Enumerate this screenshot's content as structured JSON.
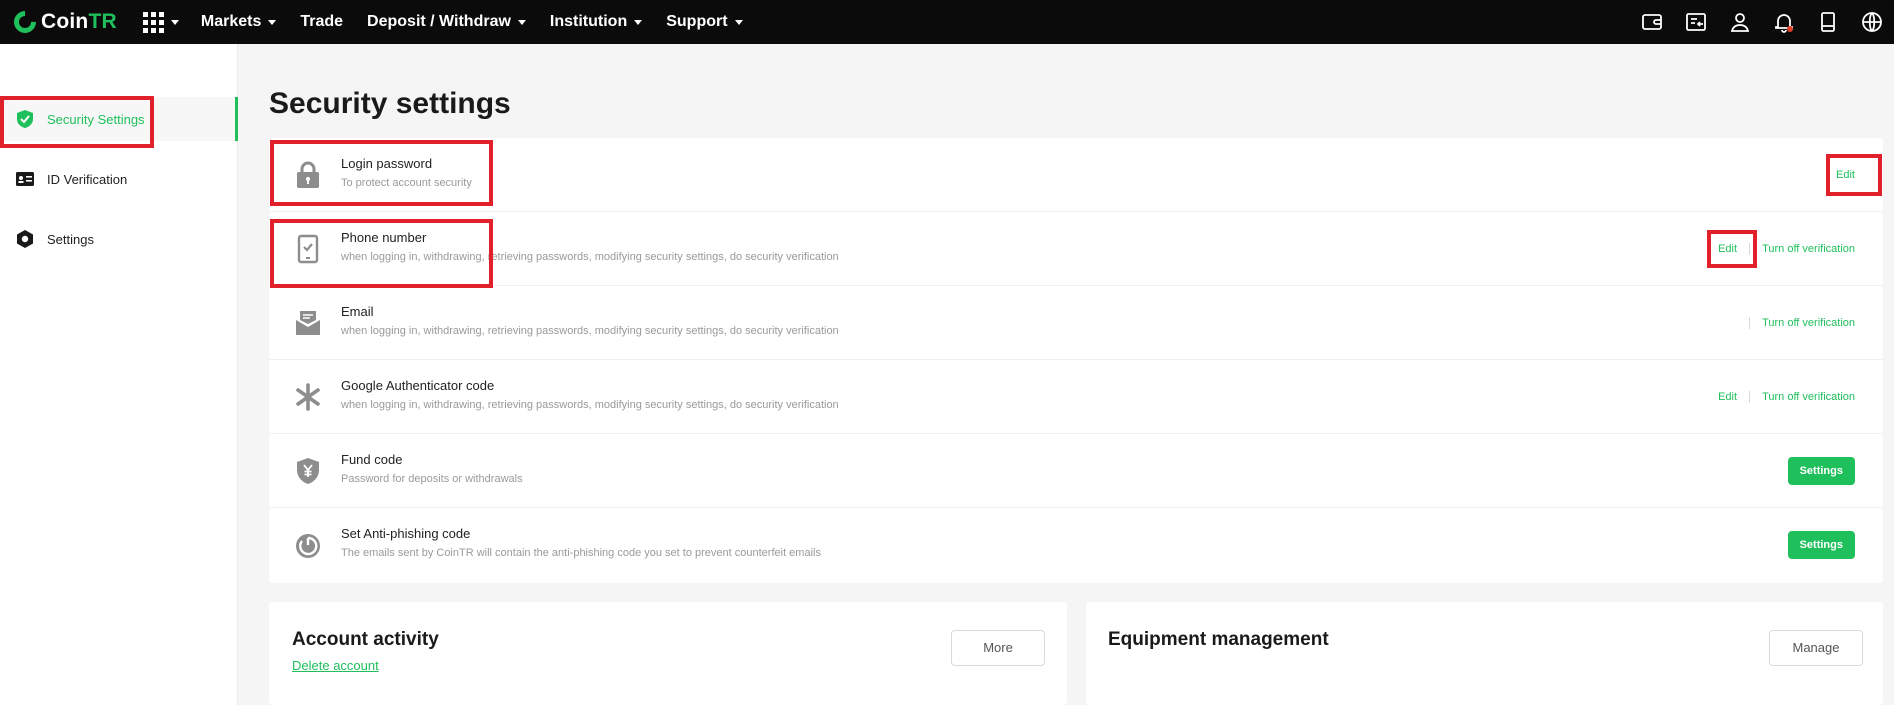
{
  "brand": {
    "name_main": "Coin",
    "name_accent": "TR"
  },
  "nav": {
    "items": [
      {
        "label": "Markets",
        "has_caret": true
      },
      {
        "label": "Trade",
        "has_caret": false
      },
      {
        "label": "Deposit / Withdraw",
        "has_caret": true
      },
      {
        "label": "Institution",
        "has_caret": true
      },
      {
        "label": "Support",
        "has_caret": true
      }
    ],
    "right_icons": [
      "wallet-icon",
      "orders-icon",
      "user-icon",
      "notification-bell-icon",
      "download-app-icon",
      "language-globe-icon"
    ]
  },
  "sidebar": {
    "items": [
      {
        "label": "Security Settings",
        "icon": "shield-check-icon",
        "active": true
      },
      {
        "label": "ID Verification",
        "icon": "id-card-icon",
        "active": false
      },
      {
        "label": "Settings",
        "icon": "gear-icon",
        "active": false
      }
    ]
  },
  "main": {
    "title": "Security settings",
    "rows": [
      {
        "title": "Login password",
        "desc": "To protect account security",
        "icon": "lock-icon",
        "actions": [
          "Edit"
        ]
      },
      {
        "title": "Phone number",
        "desc": "when logging in, withdrawing, retrieving passwords, modifying security settings, do security verification",
        "icon": "phone-icon",
        "actions": [
          "Edit",
          "Turn off verification"
        ]
      },
      {
        "title": "Email",
        "desc": "when logging in, withdrawing, retrieving passwords, modifying security settings, do security verification",
        "icon": "email-icon",
        "actions": [
          "",
          "Turn off verification"
        ]
      },
      {
        "title": "Google Authenticator code",
        "desc": "when logging in, withdrawing, retrieving passwords, modifying security settings, do security verification",
        "icon": "asterisk-icon",
        "actions": [
          "Edit",
          "Turn off verification"
        ]
      },
      {
        "title": "Fund code",
        "desc": "Password for deposits or withdrawals",
        "icon": "fund-shield-icon",
        "button": "Settings"
      },
      {
        "title": "Set Anti-phishing code",
        "desc": "The emails sent by CoinTR will contain the anti-phishing code you set to prevent counterfeit emails",
        "icon": "anti-phishing-icon",
        "button": "Settings"
      }
    ]
  },
  "account_activity": {
    "title": "Account activity",
    "link": "Delete account",
    "button": "More"
  },
  "equipment": {
    "title": "Equipment management",
    "button": "Manage"
  },
  "colors": {
    "accent": "#1fbf5b",
    "topbar": "#0b0b0b",
    "highlight": "#e0202a"
  }
}
